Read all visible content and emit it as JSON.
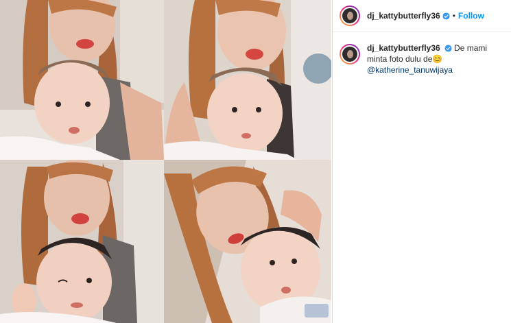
{
  "post": {
    "username": "dj_kattybutterfly36",
    "follow_label": "Follow",
    "separator": "•",
    "caption": {
      "username": "dj_kattybutterfly36",
      "text": "De mami minta foto dulu de",
      "emoji": "😊",
      "mention": "@katherine_tanuwijaya"
    }
  },
  "colors": {
    "follow": "#0095f6",
    "verified": "#3897f0",
    "mention": "#00376b"
  },
  "icons": {
    "verified": "verified-badge-icon"
  }
}
